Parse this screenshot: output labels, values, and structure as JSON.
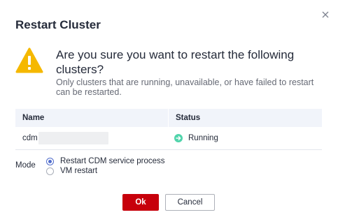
{
  "dialog": {
    "title": "Restart Cluster",
    "question": "Are you sure you want to restart the following clusters?",
    "note": "Only clusters that are running, unavailable, or have failed to restart can be restarted."
  },
  "table": {
    "headers": {
      "name": "Name",
      "status": "Status"
    },
    "rows": [
      {
        "name": "cdm",
        "status": "Running"
      }
    ]
  },
  "mode": {
    "label": "Mode",
    "options": [
      {
        "label": "Restart CDM service process",
        "checked": true
      },
      {
        "label": "VM restart",
        "checked": false
      }
    ]
  },
  "buttons": {
    "ok": "Ok",
    "cancel": "Cancel"
  },
  "colors": {
    "primary": "#c7000b",
    "radio_accent": "#526ecc",
    "warning": "#f5b800",
    "running": "#50d4ab",
    "table_header_bg": "#f1f4fa"
  },
  "icons": {
    "close": "close-icon",
    "warning": "warning-icon",
    "status": "running-status-icon"
  }
}
